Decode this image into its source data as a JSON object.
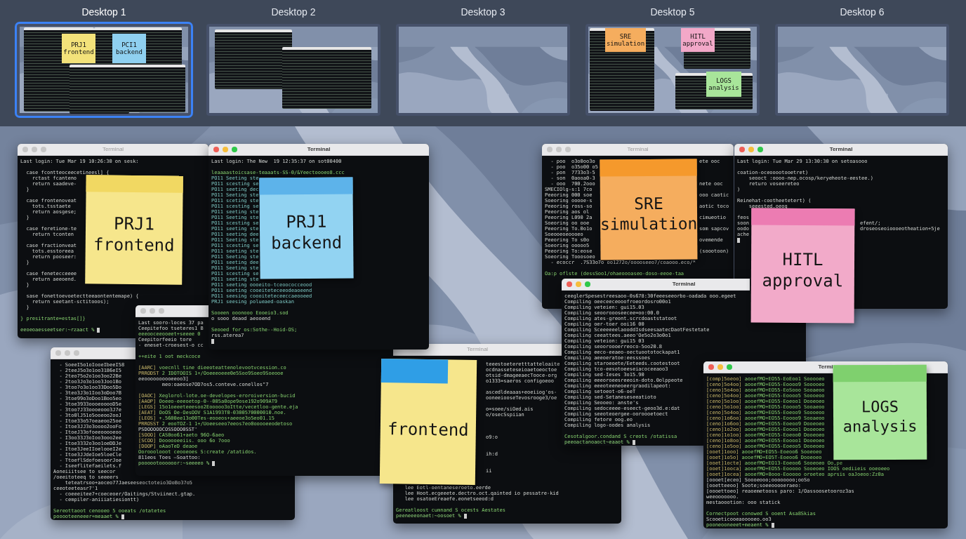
{
  "spaces": [
    {
      "label": "Desktop 1",
      "selected": true,
      "kind": "terminals",
      "notes": [
        {
          "lines": [
            "PRJ1",
            "frontend"
          ],
          "color": "#f3e27a"
        },
        {
          "lines": [
            "PCI1",
            "backend"
          ],
          "color": "#8fd0f0"
        }
      ]
    },
    {
      "label": "Desktop 2",
      "selected": false,
      "kind": "terminals"
    },
    {
      "label": "Desktop 3",
      "selected": false,
      "kind": "empty"
    },
    {
      "label": "Desktop 5",
      "selected": false,
      "kind": "terminals",
      "notes": [
        {
          "lines": [
            "SRE",
            "simulation"
          ],
          "color": "#f5ad5e"
        },
        {
          "lines": [
            "HITL",
            "approval"
          ],
          "color": "#f2a8c8"
        },
        {
          "lines": [
            "LOGS",
            "analysis"
          ],
          "color": "#a8e59a"
        }
      ]
    },
    {
      "label": "Desktop 6",
      "selected": false,
      "kind": "empty"
    }
  ],
  "windows": [
    {
      "title": "Terminal",
      "active": false,
      "lines": [
        {
          "kind": "plain",
          "text": "Last login: Tue Mar 19 10:26:30 on sesk:"
        },
        {
          "kind": "blank"
        },
        {
          "kind": "plain",
          "text": "  case fcontteoceecetineesl] {"
        },
        {
          "kind": "plain",
          "text": "    rctast fcanteno"
        },
        {
          "kind": "plain",
          "text": "    return saadeve-"
        },
        {
          "kind": "plain",
          "text": "  }"
        },
        {
          "kind": "blank"
        },
        {
          "kind": "plain",
          "text": "  case frontenoveat"
        },
        {
          "kind": "plain",
          "text": "    tots.tsstaete"
        },
        {
          "kind": "plain",
          "text": "    return aosgese;"
        },
        {
          "kind": "plain",
          "text": "  }"
        },
        {
          "kind": "blank"
        },
        {
          "kind": "plain",
          "text": "  case feretione-te"
        },
        {
          "kind": "plain",
          "text": "    return tconten"
        },
        {
          "kind": "blank"
        },
        {
          "kind": "plain",
          "text": "  case fractionveat"
        },
        {
          "kind": "plain",
          "text": "    tots.esstoreea"
        },
        {
          "kind": "plain",
          "text": "    return pooseer:"
        },
        {
          "kind": "plain",
          "text": "  }"
        },
        {
          "kind": "blank"
        },
        {
          "kind": "plain",
          "text": "  case fenetecceeee"
        },
        {
          "kind": "plain",
          "text": "    return aeeoend."
        },
        {
          "kind": "plain",
          "text": "  }"
        },
        {
          "kind": "blank"
        },
        {
          "kind": "plain",
          "text": "  sase fonettoevoetectteeaontentemape) {"
        },
        {
          "kind": "plain",
          "text": "    return seetant-sctitooos);"
        },
        {
          "kind": "plain",
          "text": "  }"
        },
        {
          "kind": "blank"
        },
        {
          "kind": "green",
          "text": "} presitrante=estas[]}"
        },
        {
          "kind": "blank"
        },
        {
          "kind": "prompt",
          "text": "eeoeoaesseetser:~rzaact %",
          "cursor": true
        }
      ]
    },
    {
      "title": "Terminal",
      "active": true,
      "lines": [
        {
          "kind": "plain",
          "text": "Last login: The New  19 12:35:37 on sot00400"
        },
        {
          "kind": "blank"
        },
        {
          "kind": "green",
          "text": "leaaaastoicsase-teaaats-SS-0/&Yeectoooeo8.ccc"
        },
        {
          "kind": "cyan",
          "text": "PO11 Seeting ste"
        },
        {
          "kind": "cyan",
          "text": "PO11 scesting se"
        },
        {
          "kind": "cyan",
          "text": "PO11 seeting dec"
        },
        {
          "kind": "cyan",
          "text": "PO11 Seeting ste"
        },
        {
          "kind": "cyan",
          "text": "PO11 sceting ste"
        },
        {
          "kind": "cyan",
          "text": "PO11 scesting se"
        },
        {
          "kind": "cyan",
          "text": "PO11 seeting ste"
        },
        {
          "kind": "cyan",
          "text": "PO11 Seeting ste"
        },
        {
          "kind": "cyan",
          "text": "PO11 scesting se"
        },
        {
          "kind": "cyan",
          "text": "PO11 seeting ste"
        },
        {
          "kind": "cyan",
          "text": "PO11 seeting dee"
        },
        {
          "kind": "cyan",
          "text": "PO11 Seeting ste"
        },
        {
          "kind": "cyan",
          "text": "PO11 scesting se"
        },
        {
          "kind": "cyan",
          "text": "PO11 seeting ste"
        },
        {
          "kind": "cyan",
          "text": "PO11 Seeting ste"
        },
        {
          "kind": "cyan",
          "text": "PO11 seeting dee"
        },
        {
          "kind": "cyan",
          "text": "PO11 Seeting ste"
        },
        {
          "kind": "cyan",
          "text": "PO11 scesting se"
        },
        {
          "kind": "cyan",
          "text": "PO11 seeting ste"
        },
        {
          "kind": "cyan",
          "text": "PO11 seeting oooeito-tceoococceood"
        },
        {
          "kind": "cyan",
          "text": "PO11 seeting cooeiteteceeodeaoeend"
        },
        {
          "kind": "cyan",
          "text": "PO11 seesing coooiteteceeccaeooeed"
        },
        {
          "kind": "cyan",
          "text": "PRJ1 seesing polueaed-oaskan"
        },
        {
          "kind": "blank"
        },
        {
          "kind": "green",
          "text": "Sooeen ooonooo Eooeio3.sod"
        },
        {
          "kind": "plain",
          "text": "o sooo deaod aeooend"
        },
        {
          "kind": "blank"
        },
        {
          "kind": "green",
          "text": "Seooed for os:Sothe--Hoid-OS;"
        },
        {
          "kind": "plain",
          "text": "rss.aterea7"
        },
        {
          "kind": "cursor"
        }
      ]
    },
    {
      "lines": [
        {
          "kind": "plain",
          "text": "  - SoeeI5o1oIooeIbeeI58"
        },
        {
          "kind": "plain",
          "text": "  - 2teeJ5o3o1oo3186eI5"
        },
        {
          "kind": "plain",
          "text": "  - 2teo75o2o1oo3oo22Be"
        },
        {
          "kind": "plain",
          "text": "  - 2too3Jo3o1oo3Joo1Bo"
        },
        {
          "kind": "plain",
          "text": "  - 3too7o3o1oo33Doo5Do"
        },
        {
          "kind": "plain",
          "text": "  - 3teo3J3o1Ioo3oDoo7B"
        },
        {
          "kind": "plain",
          "text": "  - 3toe99o3oDoo1Boo5eo"
        },
        {
          "kind": "plain",
          "text": "  - 3toe3933oooeooooD5e"
        },
        {
          "kind": "plain",
          "text": "  - 3too7J33oooeooo3J7e"
        },
        {
          "kind": "plain",
          "text": "  - 3to0lJ51o5ooeoo2ooJ"
        },
        {
          "kind": "plain",
          "text": "  - Itoe33o57oeaeoo25oe"
        },
        {
          "kind": "plain",
          "text": "  - Itoe3JJ3o3oooo2ooFo"
        },
        {
          "kind": "plain",
          "text": "  - ItoeJ33ofoeeooooeoo"
        },
        {
          "kind": "plain",
          "text": "  - I3oo33J3oIoo3ooo2ee"
        },
        {
          "kind": "plain",
          "text": "  - Itoe3332o3oo1oeDDJe"
        },
        {
          "kind": "plain",
          "text": "  - Itoe3JeeIIoelooeI2e"
        },
        {
          "kind": "plain",
          "text": "  - Itoe3JJdeIoe5loeCle"
        },
        {
          "kind": "plain",
          "text": "  - TtoeflSdofoesoorJoe"
        },
        {
          "kind": "plain",
          "text": "  - Iseeflitefaeilets.f"
        },
        {
          "kind": "plain",
          "text": "Aoneiiitsee to seecor"
        },
        {
          "kind": "plain",
          "text": "/oeeitoteeq to seeeers"
        },
        {
          "kind": "plain",
          "text": "    teteatrsoo+aoceo77Jaeseeseoctoteio3OoBo37o5"
        },
        {
          "kind": "plain",
          "text": "ceeoteeteasr7'1"
        },
        {
          "kind": "plain",
          "text": "  - coeeeitee7+coeceoer/Oaitings/Stviinect.gtap."
        },
        {
          "kind": "plain",
          "text": "  - cempiler-aniiiatiesiontt)"
        },
        {
          "kind": "blank"
        },
        {
          "kind": "green",
          "text": "Sereottaoot cenooeo 5 ooeats /otatetes"
        },
        {
          "kind": "prompt",
          "text": "pooooteeneeer+meaaet %",
          "cursor": true
        }
      ]
    },
    {
      "lines": [
        {
          "kind": "plain",
          "text": "Last sooro-loces 37 pa"
        },
        {
          "kind": "plain",
          "text": "Ceepitefoo tseteres1 B"
        },
        {
          "kind": "green",
          "text": "eeeooceeooeet+seeee 0"
        },
        {
          "kind": "plain",
          "text": "Ceepitorfeeio tore"
        },
        {
          "kind": "plain",
          "text": "- eneset-croesest-o cc"
        },
        {
          "kind": "blank"
        },
        {
          "kind": "green",
          "text": "++eite 1 oot meckcoce"
        },
        {
          "kind": "blank"
        },
        {
          "kind": "tag",
          "tag": "[AARC]",
          "text": " voecnll tine dieeoteattenolevootvcession.co"
        },
        {
          "kind": "tag",
          "tag": "PRRODST",
          "text": " 2 IDOTOOIS 1+/Ooeeeoeee0e5Soo9Soeo9Soeooe"
        },
        {
          "kind": "plain",
          "text": "eeoooooooooeeoo3]"
        },
        {
          "kind": "plain",
          "text": "        meo:oaeose7OD7os5.conteve.conellos\"7"
        },
        {
          "kind": "blank"
        },
        {
          "kind": "tag",
          "tag": "[OAOC]",
          "text": " Xeglorol-lote.oe-developes-eroroiversion-bucid"
        },
        {
          "kind": "tag",
          "tag": "[AAOP]",
          "text": " Ooeeo-eeeoetop-0--005a0ope9ose192o909AT9"
        },
        {
          "kind": "tag",
          "tag": "[LEGS]",
          "text": " 15o1oeeeteeesoo2Eooooo3oItte/vecetloo-gente.eja"
        },
        {
          "kind": "tag",
          "tag": "[AEAT]",
          "text": " OoOS Oe-OesOOV S1A1993T0-0300570000010.noe."
        },
        {
          "kind": "tag",
          "tag": "[LEOS]",
          "text": " +.5600ee13o00Tes-eooeos+aeeoe3o5eo01.15"
        },
        {
          "kind": "tag",
          "tag": "PRROSST",
          "text": " 2 eooTOZ-1 1+/Uoeeseeo7eeos7eo0ooooeeodetoso"
        },
        {
          "kind": "plain",
          "text": "PSDOOOOOCOSSOOO0SST'"
        },
        {
          "kind": "tag",
          "tag": "[SOOO]",
          "text": " CAS0oo61+aeto 96O-6aeo"
        },
        {
          "kind": "tag",
          "tag": "[SCOO]",
          "text": " Doooooeeiis. ooo 6o 7ooo"
        },
        {
          "kind": "tag",
          "tag": "[DOOP]",
          "text": " oAaoTeD deaoe"
        },
        {
          "kind": "green",
          "text": "Oorooolooot ceooeoes S:create /atatidos."
        },
        {
          "kind": "plain",
          "text": "811eos Toes —Soattoo:"
        },
        {
          "kind": "prompt",
          "text": "poooootoooooor:~seeeeo %",
          "cursor": true
        }
      ]
    },
    {
      "title": "Terminal",
      "active": false,
      "lines": [
        {
          "kind": "plain",
          "text": "teeestoeteretttatteloaite"
        },
        {
          "kind": "plain",
          "text": "ocdnasseteseioaetoeoctoe"
        },
        {
          "kind": "plain",
          "text": "otsid-dmageeaecTooce-org"
        },
        {
          "kind": "plain",
          "text": "o1333=saeros configoeoo"
        },
        {
          "kind": "blank"
        },
        {
          "kind": "plain",
          "text": "ascedldeaaas+eoeiiog'os-"
        },
        {
          "kind": "plain",
          "text": "ooneeiooseTevosrooge3/oe"
        },
        {
          "kind": "blank"
        },
        {
          "kind": "plain",
          "text": "o=soee/siOed.ais"
        },
        {
          "kind": "plain",
          "text": "o/osecSspiian"
        },
        {
          "kind": "blank"
        },
        {
          "kind": "blank"
        },
        {
          "kind": "blank"
        },
        {
          "kind": "plain",
          "text": "o9:o"
        },
        {
          "kind": "blank"
        },
        {
          "kind": "blank"
        },
        {
          "kind": "plain",
          "text": "ih:d"
        },
        {
          "kind": "blank"
        },
        {
          "kind": "blank"
        },
        {
          "kind": "plain",
          "text": "ii"
        },
        {
          "kind": "blank"
        },
        {
          "kind": "blank"
        },
        {
          "kind": "plain",
          "text": "   lee Eotl-oentaneseroeto.eerde"
        },
        {
          "kind": "plain",
          "text": "   lee Hoot.ecgeeete.dectro.oct.qainted io pessatre-kid"
        },
        {
          "kind": "plain",
          "text": "   lee osatoeEreaefe.eonetseeod:d"
        },
        {
          "kind": "blank"
        },
        {
          "kind": "green",
          "text": "Gereatloost cumnand S ocests Aestates"
        },
        {
          "kind": "prompt",
          "text": "peeneeeonaet:~oosoet %",
          "cursor": true
        }
      ]
    },
    {
      "title": "Terminal",
      "active": false,
      "lines": [
        {
          "kind": "plain",
          "text": "  - poo  o3o0oo3o",
          "tail": "ete ooc"
        },
        {
          "kind": "plain",
          "text": "  - poo  o35o00 o5"
        },
        {
          "kind": "plain",
          "text": "  - pon  7733o3-5"
        },
        {
          "kind": "plain",
          "text": "  - son  0aooa0-3"
        },
        {
          "kind": "plain",
          "text": "  - ooo  700.2ooo",
          "tail": "nete ooc"
        },
        {
          "kind": "plain",
          "text": "SMECIOlg-s:1 7co"
        },
        {
          "kind": "plain",
          "text": "Peeoring 000 soe",
          "tail": "ooo caotic"
        },
        {
          "kind": "plain",
          "text": "Soeoring ooooe-s"
        },
        {
          "kind": "plain",
          "text": "Peeoring ross-so",
          "tail": "aotic toco"
        },
        {
          "kind": "plain",
          "text": "Peeoring aos ol"
        },
        {
          "kind": "plain",
          "text": "Peeoring L090 2a",
          "tail": "cimueotio"
        },
        {
          "kind": "plain",
          "text": "Soeoring oo ooe"
        },
        {
          "kind": "plain",
          "text": "Peeoring To.0o1o",
          "tail": "som sapcov"
        },
        {
          "kind": "plain",
          "text": "Soeooeoeoooeo"
        },
        {
          "kind": "plain",
          "text": "Peeoring To s0o",
          "tail": "ovemende"
        },
        {
          "kind": "plain",
          "text": "Soeoring ooooo5"
        },
        {
          "kind": "plain",
          "text": "Peeoring To:eose",
          "tail": "(soootoon)"
        },
        {
          "kind": "plain",
          "text": "Soeoring Tooosoeo"
        },
        {
          "kind": "plain",
          "text": "  - ecoccr  .7S33o7o oo1272o/ooooseeo7/coaooo.eco/*"
        },
        {
          "kind": "blank"
        },
        {
          "kind": "green",
          "text": "Oa:p oflste (dessSoo1/ohaeoooaseo-doso-eeoe-taa"
        }
      ]
    },
    {
      "title": "Terminal",
      "active": true,
      "lines": [
        {
          "kind": "plain",
          "text": "Last login: Tue Mar 29 13:30:30 on setoasooo"
        },
        {
          "kind": "blank"
        },
        {
          "kind": "plain",
          "text": "coation-oceooootooetret)"
        },
        {
          "kind": "plain",
          "text": "    seooct :oooo-nep.ocosp/keryeheote-eestee.)"
        },
        {
          "kind": "plain",
          "text": "    returo voseereteo"
        },
        {
          "kind": "plain",
          "text": ")"
        },
        {
          "kind": "blank"
        },
        {
          "kind": "plain",
          "text": "Reinehat-cootheetetert) ("
        },
        {
          "kind": "plain",
          "text": "    seeested.oeog"
        },
        {
          "kind": "blank"
        },
        {
          "kind": "plain",
          "text": "feos"
        },
        {
          "kind": "plain",
          "text": "soon",
          "tail": "efent/;"
        },
        {
          "kind": "plain",
          "text": "oodo",
          "tail": "droseoseoioooeotheation+5je"
        },
        {
          "kind": "plain",
          "text": "ache"
        },
        {
          "kind": "cursor"
        }
      ]
    },
    {
      "title": "Terminal",
      "active": true,
      "lines": [
        {
          "kind": "plain",
          "text": "ceeglerSpesestreesaoo-0s678:30feeeseeorbo-oadada ooo.egeet"
        },
        {
          "kind": "plain",
          "text": "Compiling oeeceeceooofroeordosro00o1"
        },
        {
          "kind": "plain",
          "text": "Compiling veteien: gui15.03"
        },
        {
          "kind": "plain",
          "text": "Compiling seooroooseecee=oo:00.0"
        },
        {
          "kind": "plain",
          "text": "Compiling ates-greont.scrcdoaststatoot"
        },
        {
          "kind": "plain",
          "text": "Compiling oer-toer ooi16 00"
        },
        {
          "kind": "plain",
          "text": "Compiling SceeeeeelaooddIsdseesaatecDaotFestetate"
        },
        {
          "kind": "plain",
          "text": "Compiling ceeattees.aeeo'Oe5o2o3o0o1"
        },
        {
          "kind": "plain",
          "text": "Compiling veteion: gui15 03"
        },
        {
          "kind": "plain",
          "text": "Compiling seooroooerreoco-5oo20.8"
        },
        {
          "kind": "plain",
          "text": "Compiling eeco-eeaeo-oectuoototockapat1"
        },
        {
          "kind": "plain",
          "text": "Compiling aeeoeratoe:eesssoes"
        },
        {
          "kind": "plain",
          "text": "Compiling staroeoete/Eeteeds.cootestoot"
        },
        {
          "kind": "plain",
          "text": "Compiling tco-eesotoeeseiacoceeaoo3"
        },
        {
          "kind": "plain",
          "text": "Compiling sed-Ieses 3o15.90"
        },
        {
          "kind": "plain",
          "text": "Compiling eeeoroeesreeoin-doto.0olppeote"
        },
        {
          "kind": "plain",
          "text": "Compiling eeeoteeneoeergraodilapeot:"
        },
        {
          "kind": "plain",
          "text": "Compiling setoeot-o6-oeT"
        },
        {
          "kind": "plain",
          "text": "Compiling sed-Setaneseseeatioto"
        },
        {
          "kind": "plain",
          "text": "Compiling Seooeo: anste's"
        },
        {
          "kind": "plain",
          "text": "Compiling sedoceeee-eseect-geoo3d.e:dat"
        },
        {
          "kind": "plain",
          "text": "Compiling seeoteoergee-ooroooetoect"
        },
        {
          "kind": "plain",
          "text": "Compiling fetore oog.eo"
        },
        {
          "kind": "plain",
          "text": "Compiling logo-oodes analysis"
        },
        {
          "kind": "blank"
        },
        {
          "kind": "green",
          "text": "Cesotalgoor.condand S creots /otatissa"
        },
        {
          "kind": "prompt",
          "text": "peeoactanoaoct~eaaot %",
          "cursor": true
        }
      ]
    },
    {
      "title": "Termi",
      "active": true,
      "lines": [
        {
          "kind": "tag",
          "tag": "[comp]5oeoo]",
          "text": " aooefMO+EO55-EoEoo1 Sooooeo"
        },
        {
          "kind": "tag",
          "tag": "[ceno]5o4oo]",
          "text": " aooefMO+EO55-Eoooo9 Sooooeo"
        },
        {
          "kind": "tag",
          "tag": "[ceno]5o4oo]",
          "text": " aooefMO+EO55-EoSooo Sooaeoo"
        },
        {
          "kind": "tag",
          "tag": "[ceno]5o4oo]",
          "text": " aooefMO+EO55-Eoooo5 Soooeoo"
        },
        {
          "kind": "tag",
          "tag": "[ceno]5o1oo]",
          "text": " aooefMO+EO55-Eoeoo1 Dooeoeo"
        },
        {
          "kind": "tag",
          "tag": "[ceno]5o1oo]",
          "text": " aooefMO+EO55-Eoooo5 Sooaeoo"
        },
        {
          "kind": "tag",
          "tag": "[ceno]5o4oo]",
          "text": " aooefMO+EO55-Eoeoo9 Soooeoo"
        },
        {
          "kind": "tag",
          "tag": "[ceno]1o6oo]",
          "text": " aooefMO+EO55-Eoooo9 Sooaeoo"
        },
        {
          "kind": "tag",
          "tag": "[ceno]1o6oo]",
          "text": " aooefMO+EO55-Eoeoo9 Dooeoeo"
        },
        {
          "kind": "tag",
          "tag": "[ceno]1o2oo]",
          "text": " aooefMO+EO55-Eoooo1 Dooeoeo"
        },
        {
          "kind": "tag",
          "tag": "[ceno]1o1oo]",
          "text": " aooefMO+EO55-Eoeoo0 Dooeoeo"
        },
        {
          "kind": "tag",
          "tag": "[ceno]1o8oo]",
          "text": " aooefMO+EO55-Eoooo1 Dooeoeo"
        },
        {
          "kind": "tag",
          "tag": "[ceno]1o5oo]",
          "text": " aooefMO+EO55-Eoeoo5 Dooeoeo"
        },
        {
          "kind": "tag",
          "tag": "[ooet]1ooo]",
          "text": " aooefMO+EO55-Eoeoo6 Sooeoeo"
        },
        {
          "kind": "tag",
          "tag": "[ooet]1o5o]",
          "text": " aooefMO+EO5T-Eoeoo6 Dooeoeo"
        },
        {
          "kind": "tag",
          "tag": "[ooet]1octe]",
          "text": " aooefMO+EO13-Eoeoo6 Sooeoeo Oo,pe"
        },
        {
          "kind": "tag",
          "tag": "[ooet]1ooca]",
          "text": " aooefMO+EO55-Eooooo Sooeoeo IOOS oediieis ooeoeeo"
        },
        {
          "kind": "tag",
          "tag": "[ooet]1ocea]",
          "text": " aooefMO+8ooo-Eooooo oroeteo aprsis oaJoeoo:Zz0a"
        },
        {
          "kind": "plain",
          "text": "[oooet[eceo] Soooeooo;oooooooo;ooSo"
        },
        {
          "kind": "plain",
          "text": "[ooetteeoo] Soote;soeeooooeraeo:"
        },
        {
          "kind": "plain",
          "text": "[oooettoeo] reaoemetooss paro: 1/Oassoosetooroz3as"
        },
        {
          "kind": "plain",
          "text": "weeooooooo."
        },
        {
          "kind": "plain",
          "text": "mestaoootion: ooo statick"
        },
        {
          "kind": "blank"
        },
        {
          "kind": "green",
          "text": "Cornectpoot conowed S ooent Asa8Skias"
        },
        {
          "kind": "plain",
          "text": "Scooeticooeaooooeo.oo3"
        },
        {
          "kind": "prompt",
          "text": "pooneooneeet+meaent %",
          "cursor": true
        }
      ]
    }
  ],
  "notes": [
    {
      "lines": [
        "PRJ1",
        "frontend"
      ],
      "color": "#f6e68c",
      "tape": {
        "color": "#f1d862"
      }
    },
    {
      "lines": [
        "PRJ1",
        "backend"
      ],
      "color": "#92d3f2",
      "tape": {
        "color": "#5db3ea"
      }
    },
    {
      "lines": [
        "frontend"
      ],
      "color": "#f6e68c",
      "tape": {
        "color": "#2f9ee6"
      }
    },
    {
      "lines": [
        "SRE",
        "simulation"
      ],
      "color": "#f5ad5e",
      "tape": {
        "color": "#f5992c"
      }
    },
    {
      "lines": [
        "HITL",
        "approval"
      ],
      "color": "#f2aac9",
      "tape": {
        "color": "#ec7cb2"
      }
    },
    {
      "lines": [
        "LOGS",
        "analysis"
      ],
      "color": "#a8e59a",
      "tape": {
        "color": "#7fd06e"
      }
    }
  ]
}
